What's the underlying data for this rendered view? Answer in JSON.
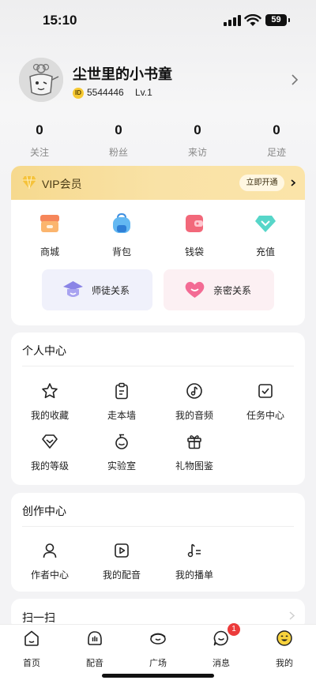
{
  "status_bar": {
    "time": "15:10",
    "battery": "59"
  },
  "profile": {
    "username": "尘世里的小书童",
    "id_badge": "ID",
    "user_id": "5544446",
    "level": "Lv.1"
  },
  "stats": [
    {
      "value": "0",
      "label": "关注"
    },
    {
      "value": "0",
      "label": "粉丝"
    },
    {
      "value": "0",
      "label": "来访"
    },
    {
      "value": "0",
      "label": "足迹"
    }
  ],
  "vip": {
    "title": "VIP会员",
    "button": "立即开通",
    "quick": [
      {
        "label": "商城",
        "icon": "shop-icon"
      },
      {
        "label": "背包",
        "icon": "backpack-icon"
      },
      {
        "label": "钱袋",
        "icon": "wallet-icon"
      },
      {
        "label": "充值",
        "icon": "diamond-icon"
      }
    ],
    "relations": [
      {
        "label": "师徒关系",
        "icon": "mentor-icon"
      },
      {
        "label": "亲密关系",
        "icon": "heart-icon"
      }
    ]
  },
  "personal": {
    "title": "个人中心",
    "items": [
      {
        "label": "我的收藏",
        "icon": "star-icon"
      },
      {
        "label": "走本墙",
        "icon": "clipboard-icon"
      },
      {
        "label": "我的音频",
        "icon": "music-icon"
      },
      {
        "label": "任务中心",
        "icon": "task-icon"
      },
      {
        "label": "我的等级",
        "icon": "level-icon"
      },
      {
        "label": "实验室",
        "icon": "lab-icon"
      },
      {
        "label": "礼物图鉴",
        "icon": "gift-icon"
      }
    ]
  },
  "creation": {
    "title": "创作中心",
    "items": [
      {
        "label": "作者中心",
        "icon": "author-icon"
      },
      {
        "label": "我的配音",
        "icon": "play-icon"
      },
      {
        "label": "我的播单",
        "icon": "playlist-icon"
      }
    ]
  },
  "scan": {
    "title": "扫一扫"
  },
  "tabbar": {
    "items": [
      {
        "label": "首页",
        "icon": "home-icon"
      },
      {
        "label": "配音",
        "icon": "dubbing-icon"
      },
      {
        "label": "广场",
        "icon": "plaza-icon"
      },
      {
        "label": "消息",
        "icon": "message-icon"
      },
      {
        "label": "我的",
        "icon": "profile-icon"
      }
    ],
    "message_badge": "1"
  },
  "colors": {
    "vip_gold": "#f6d98e",
    "badge_red": "#ec3b3b",
    "id_yellow": "#f6c933"
  }
}
